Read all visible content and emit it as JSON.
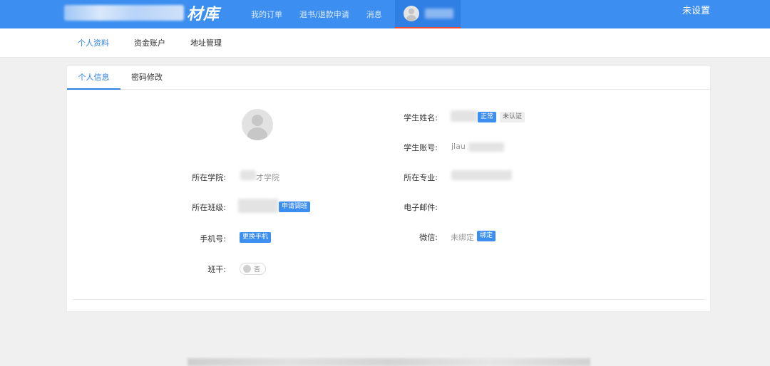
{
  "header": {
    "logo_suffix": "材库",
    "nav": [
      "我的订单",
      "退书/退款申请",
      "消息"
    ],
    "right_text": "未设置"
  },
  "subnav": {
    "items": [
      "个人资料",
      "资金账户",
      "地址管理"
    ],
    "active": "个人资料"
  },
  "tabs": {
    "items": [
      "个人信息",
      "密码修改"
    ],
    "active": "个人信息"
  },
  "profile": {
    "student_name": {
      "label": "学生姓名:",
      "status_badge": "正常",
      "auth_badge": "未认证"
    },
    "student_account": {
      "label": "学生账号:",
      "value": "jlau"
    },
    "college": {
      "label": "所在学院:",
      "value": "才学院"
    },
    "major": {
      "label": "所在专业:"
    },
    "class": {
      "label": "所在班级:",
      "button": "申请调班"
    },
    "email": {
      "label": "电子邮件:"
    },
    "phone": {
      "label": "手机号:",
      "button": "更换手机"
    },
    "wechat": {
      "label": "微信:",
      "value": "未绑定",
      "button": "绑定"
    },
    "cadre": {
      "label": "班干:",
      "toggle_label": "否",
      "toggle_on": false
    }
  },
  "colors": {
    "primary": "#3c8ef0",
    "active_text": "#2f7fe4",
    "user_tab_underline": "#e74c3c"
  }
}
